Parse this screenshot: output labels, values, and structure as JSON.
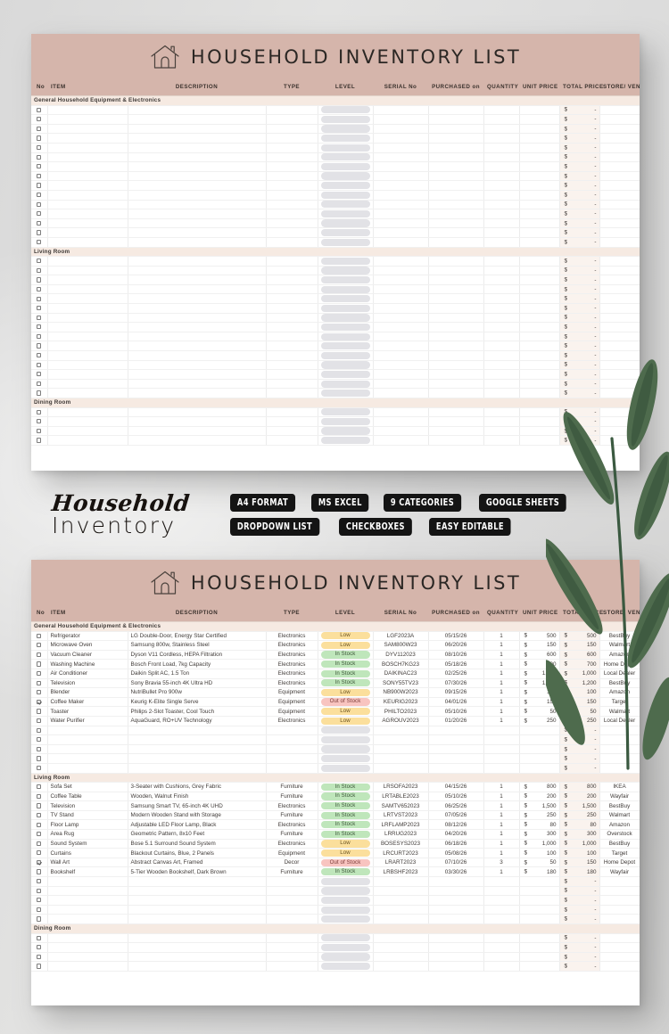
{
  "banner": {
    "title": "HOUSEHOLD INVENTORY LIST",
    "icon": "house-icon",
    "bg_color": "#d5b5ab"
  },
  "columns": [
    {
      "key": "no",
      "label": "No"
    },
    {
      "key": "item",
      "label": "ITEM"
    },
    {
      "key": "desc",
      "label": "DESCRIPTION"
    },
    {
      "key": "type",
      "label": "TYPE"
    },
    {
      "key": "level",
      "label": "LEVEL"
    },
    {
      "key": "ser",
      "label": "SERIAL No"
    },
    {
      "key": "date",
      "label": "PURCHASED on"
    },
    {
      "key": "qty",
      "label": "QUANTITY"
    },
    {
      "key": "unit",
      "label": "UNIT PRICE"
    },
    {
      "key": "total",
      "label": "TOTAL PRICE"
    },
    {
      "key": "store",
      "label": "STORE/ VENDOR"
    }
  ],
  "currency_symbol": "$",
  "empty_total_dash": "-",
  "level_states": {
    "in_stock": "In Stock",
    "low": "Low",
    "out_of_stock": "Out of Stock"
  },
  "blank_sheet": {
    "sections": [
      {
        "title": "General Household Equipment & Electronics",
        "blank_rows": 15
      },
      {
        "title": "Living Room",
        "blank_rows": 15
      },
      {
        "title": "Dining Room",
        "blank_rows": 4
      }
    ]
  },
  "filled_sheet": {
    "sections": [
      {
        "title": "General Household Equipment & Electronics",
        "blank_rows": 5,
        "rows": [
          {
            "checked": false,
            "item": "Refrigerator",
            "desc": "LG Double-Door, Energy Star Certified",
            "type": "Electronics",
            "level": "Low",
            "level_state": "low",
            "ser": "LGF2023A",
            "date": "05/15/26",
            "qty": "1",
            "unit": "500",
            "total": "500",
            "store": "BestBuy"
          },
          {
            "checked": false,
            "item": "Microwave Oven",
            "desc": "Samsung 800w, Stainless Steel",
            "type": "Electronics",
            "level": "Low",
            "level_state": "low",
            "ser": "SAM800W23",
            "date": "06/20/26",
            "qty": "1",
            "unit": "150",
            "total": "150",
            "store": "Walmart"
          },
          {
            "checked": false,
            "item": "Vacuum Cleaner",
            "desc": "Dyson V11 Cordless, HEPA Filtration",
            "type": "Electronics",
            "level": "In Stock",
            "level_state": "in_stock",
            "ser": "DYV112023",
            "date": "08/10/26",
            "qty": "1",
            "unit": "600",
            "total": "600",
            "store": "Amazon"
          },
          {
            "checked": false,
            "item": "Washing Machine",
            "desc": "Bosch Front Load, 7kg Capacity",
            "type": "Electronics",
            "level": "In Stock",
            "level_state": "in_stock",
            "ser": "BOSCH7KG23",
            "date": "05/18/26",
            "qty": "1",
            "unit": "700",
            "total": "700",
            "store": "Home Depot"
          },
          {
            "checked": false,
            "item": "Air Conditioner",
            "desc": "Daikin Split AC, 1.5 Ton",
            "type": "Electronics",
            "level": "In Stock",
            "level_state": "in_stock",
            "ser": "DAIKINAC23",
            "date": "02/25/26",
            "qty": "1",
            "unit": "1,000",
            "total": "1,000",
            "store": "Local Dealer"
          },
          {
            "checked": false,
            "item": "Television",
            "desc": "Sony Bravia 55-inch 4K Ultra HD",
            "type": "Electronics",
            "level": "In Stock",
            "level_state": "in_stock",
            "ser": "SONY55TV23",
            "date": "07/30/26",
            "qty": "1",
            "unit": "1,200",
            "total": "1,200",
            "store": "BestBuy"
          },
          {
            "checked": false,
            "item": "Blender",
            "desc": "NutriBullet Pro 900w",
            "type": "Equipment",
            "level": "Low",
            "level_state": "low",
            "ser": "NB900W2023",
            "date": "09/15/26",
            "qty": "1",
            "unit": "100",
            "total": "100",
            "store": "Amazon"
          },
          {
            "checked": true,
            "item": "Coffee Maker",
            "desc": "Keurig K-Elite Single Serve",
            "type": "Equipment",
            "level": "Out of Stock",
            "level_state": "out_of_stock",
            "ser": "KEURIG2023",
            "date": "04/01/26",
            "qty": "1",
            "unit": "150",
            "total": "150",
            "store": "Target"
          },
          {
            "checked": false,
            "item": "Toaster",
            "desc": "Philips 2-Slot Toaster, Cool Touch",
            "type": "Equipment",
            "level": "Low",
            "level_state": "low",
            "ser": "PHILTO2023",
            "date": "05/10/26",
            "qty": "1",
            "unit": "50",
            "total": "50",
            "store": "Walmart"
          },
          {
            "checked": false,
            "item": "Water Purifier",
            "desc": "AquaGuard, RO+UV Technology",
            "type": "Electronics",
            "level": "Low",
            "level_state": "low",
            "ser": "AGROUV2023",
            "date": "01/20/26",
            "qty": "1",
            "unit": "250",
            "total": "250",
            "store": "Local Dealer"
          }
        ]
      },
      {
        "title": "Living Room",
        "blank_rows": 5,
        "rows": [
          {
            "checked": false,
            "item": "Sofa Set",
            "desc": "3-Seater with Cushions, Grey Fabric",
            "type": "Furniture",
            "level": "In Stock",
            "level_state": "in_stock",
            "ser": "LRSOFA2023",
            "date": "04/15/26",
            "qty": "1",
            "unit": "800",
            "total": "800",
            "store": "IKEA"
          },
          {
            "checked": false,
            "item": "Coffee Table",
            "desc": "Wooden, Walnut Finish",
            "type": "Furniture",
            "level": "In Stock",
            "level_state": "in_stock",
            "ser": "LRTABLE2023",
            "date": "05/10/26",
            "qty": "1",
            "unit": "200",
            "total": "200",
            "store": "Wayfair"
          },
          {
            "checked": false,
            "item": "Television",
            "desc": "Samsung Smart TV, 65-inch 4K UHD",
            "type": "Electronics",
            "level": "In Stock",
            "level_state": "in_stock",
            "ser": "SAMTV652023",
            "date": "06/25/26",
            "qty": "1",
            "unit": "1,500",
            "total": "1,500",
            "store": "BestBuy"
          },
          {
            "checked": false,
            "item": "TV Stand",
            "desc": "Modern Wooden Stand with Storage",
            "type": "Furniture",
            "level": "In Stock",
            "level_state": "in_stock",
            "ser": "LRTVST2023",
            "date": "07/05/26",
            "qty": "1",
            "unit": "250",
            "total": "250",
            "store": "Walmart"
          },
          {
            "checked": false,
            "item": "Floor Lamp",
            "desc": "Adjustable LED Floor Lamp, Black",
            "type": "Electronics",
            "level": "In Stock",
            "level_state": "in_stock",
            "ser": "LRFLAMP2023",
            "date": "08/12/26",
            "qty": "1",
            "unit": "80",
            "total": "80",
            "store": "Amazon"
          },
          {
            "checked": false,
            "item": "Area Rug",
            "desc": "Geometric Pattern, 8x10 Feet",
            "type": "Furniture",
            "level": "In Stock",
            "level_state": "in_stock",
            "ser": "LRRUG2023",
            "date": "04/20/26",
            "qty": "1",
            "unit": "300",
            "total": "300",
            "store": "Overstock"
          },
          {
            "checked": false,
            "item": "Sound System",
            "desc": "Bose 5.1 Surround Sound System",
            "type": "Electronics",
            "level": "Low",
            "level_state": "low",
            "ser": "BOSESYS2023",
            "date": "06/18/26",
            "qty": "1",
            "unit": "1,000",
            "total": "1,000",
            "store": "BestBuy"
          },
          {
            "checked": false,
            "item": "Curtains",
            "desc": "Blackout Curtains, Blue, 2 Panels",
            "type": "Equipment",
            "level": "Low",
            "level_state": "low",
            "ser": "LRCURT2023",
            "date": "05/08/26",
            "qty": "1",
            "unit": "100",
            "total": "100",
            "store": "Target"
          },
          {
            "checked": true,
            "item": "Wall Art",
            "desc": "Abstract Canvas Art, Framed",
            "type": "Decor",
            "level": "Out of Stock",
            "level_state": "out_of_stock",
            "ser": "LRART2023",
            "date": "07/10/26",
            "qty": "3",
            "unit": "50",
            "total": "150",
            "store": "Home Depot"
          },
          {
            "checked": false,
            "item": "Bookshelf",
            "desc": "5-Tier Wooden Bookshelf, Dark Brown",
            "type": "Furniture",
            "level": "In Stock",
            "level_state": "in_stock",
            "ser": "LRBSHF2023",
            "date": "03/30/26",
            "qty": "1",
            "unit": "180",
            "total": "180",
            "store": "Wayfair"
          }
        ]
      },
      {
        "title": "Dining Room",
        "blank_rows": 4,
        "rows": []
      }
    ]
  },
  "brand": {
    "line1": "Household",
    "line2": "Inventory",
    "badges": [
      "A4 FORMAT",
      "MS EXCEL",
      "9 CATEGORIES",
      "GOOGLE SHEETS",
      "DROPDOWN LIST",
      "CHECKBOXES",
      "EASY EDITABLE"
    ]
  },
  "decor": {
    "plant": "olive-branch-decoration"
  }
}
